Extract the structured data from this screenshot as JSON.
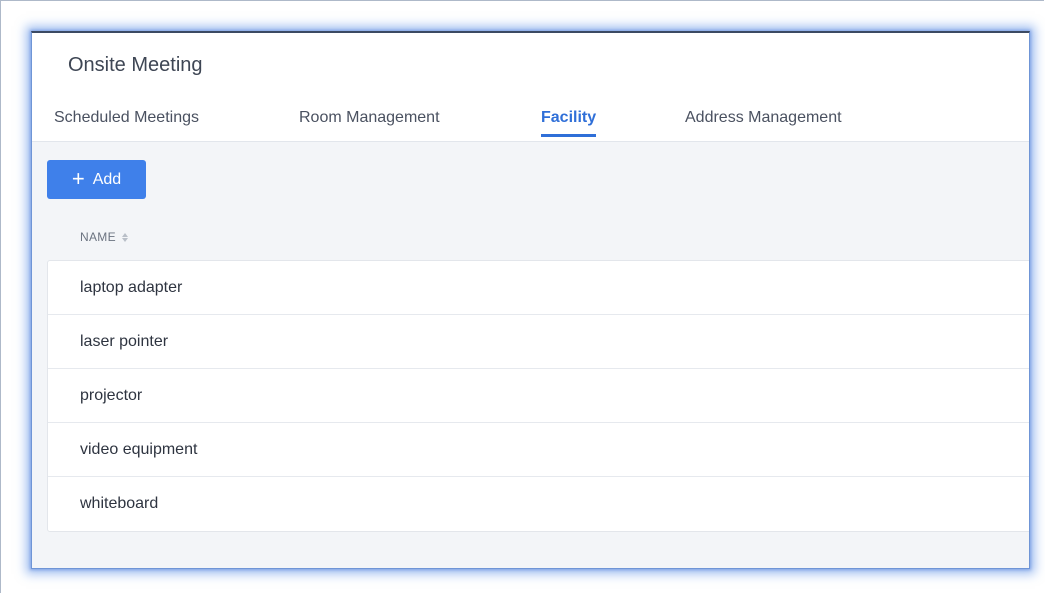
{
  "app": {
    "title": "Onsite Meeting"
  },
  "tabs": [
    {
      "label": "Scheduled Meetings",
      "active": false
    },
    {
      "label": "Room Management",
      "active": false
    },
    {
      "label": "Facility",
      "active": true
    },
    {
      "label": "Address Management",
      "active": false
    }
  ],
  "toolbar": {
    "add_label": "Add",
    "add_icon": "plus-icon"
  },
  "table": {
    "column_header": "NAME",
    "sort_icon": "sort-icon",
    "rows": [
      {
        "name": "laptop adapter"
      },
      {
        "name": "laser pointer"
      },
      {
        "name": "projector"
      },
      {
        "name": "video equipment"
      },
      {
        "name": "whiteboard"
      }
    ]
  },
  "colors": {
    "accent": "#2f6fd8",
    "button": "#3f80ea",
    "background": "#f3f5f8"
  }
}
